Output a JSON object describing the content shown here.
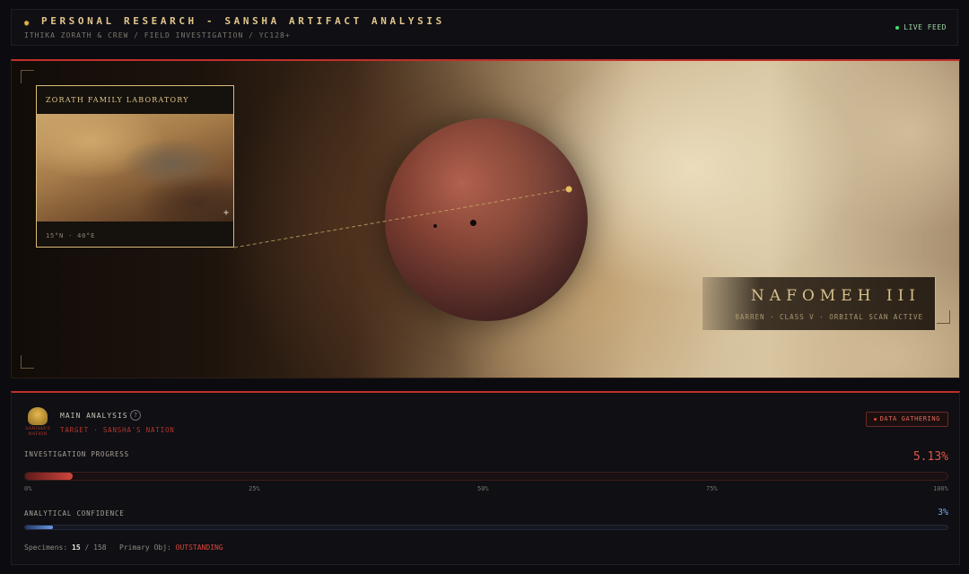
{
  "header": {
    "title": "PERSONAL RESEARCH - SANSHA ARTIFACT ANALYSIS",
    "subtitle": "ITHIKA ZORATH & CREW / FIELD INVESTIGATION / YC128+",
    "live_label": "LIVE FEED",
    "icon": "gear-icon",
    "live_color": "#3ee06a"
  },
  "scene": {
    "location_card": {
      "title": "ZORATH FAMILY LABORATORY",
      "coords": "15°N · 40°E",
      "expand_icon": "plus-icon"
    },
    "planet": {
      "name": "NAFOMEH III",
      "meta": "BARREN · CLASS V · ORBITAL SCAN ACTIVE"
    }
  },
  "analysis": {
    "label": "MAIN ANALYSIS",
    "help_glyph": "?",
    "target": "TARGET · SANSHA'S NATION",
    "emblem_text": [
      "SANSHA'S",
      "NATION"
    ],
    "status_label": "DATA GATHERING",
    "investigation": {
      "label": "INVESTIGATION PROGRESS",
      "value_text": "5.13%",
      "value": 5.13,
      "ticks": [
        "0%",
        "25%",
        "50%",
        "75%",
        "100%"
      ]
    },
    "confidence": {
      "label": "ANALYTICAL CONFIDENCE",
      "value_text": "3%",
      "value": 3
    },
    "footer": {
      "specimens_label": "Specimens:",
      "specimens_count": "15",
      "specimens_sep": "/",
      "specimens_total": "158",
      "objective_label": "Primary Obj:",
      "objective_value": "OUTSTANDING"
    }
  },
  "colors": {
    "accent": "#c0302a",
    "gold": "#e3c68a",
    "progress": "#d0463c",
    "confidence": "#6a9adf"
  }
}
